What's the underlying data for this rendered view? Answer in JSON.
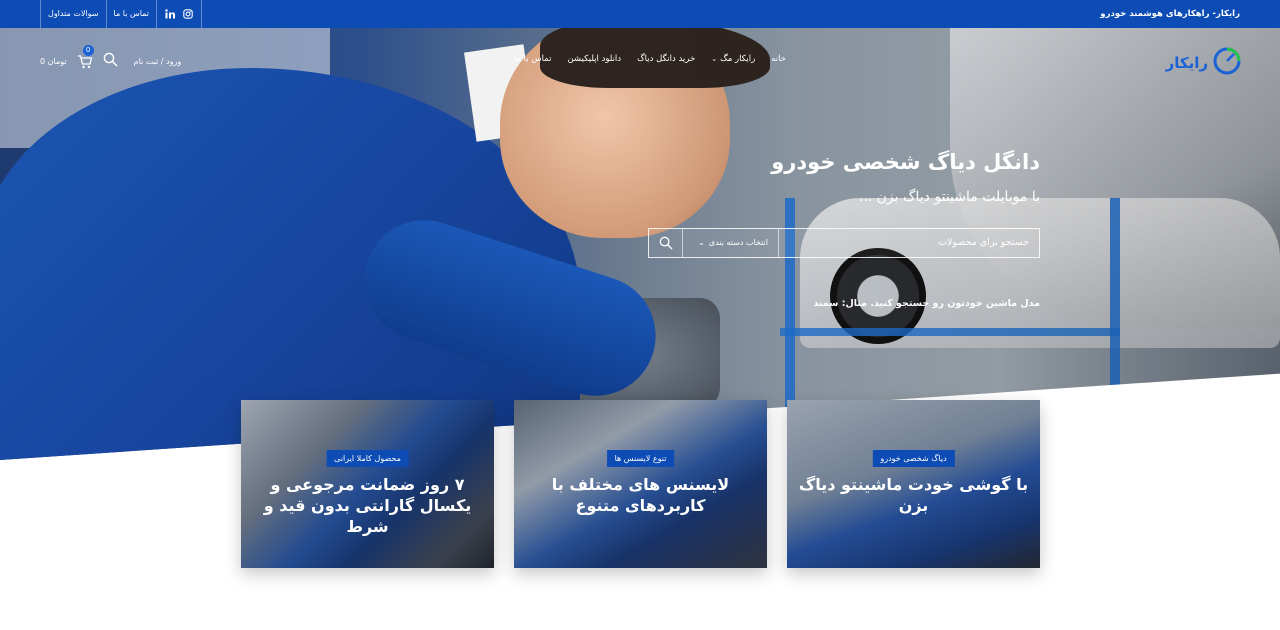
{
  "topbar": {
    "site_tag": "رایکار- راهکارهای هوشمند خودرو",
    "links": [
      "سوالات متداول",
      "تماس با ما"
    ],
    "social_icons": [
      "linkedin-icon",
      "instagram-icon"
    ]
  },
  "header": {
    "logo_text": "رایکار",
    "nav": [
      {
        "label": "خانه"
      },
      {
        "label": "رایکار مگ"
      },
      {
        "label": "خرید دانگل دیاگ"
      },
      {
        "label": "دانلود اپلیکیشن"
      },
      {
        "label": "تماس با ما"
      }
    ],
    "login_label": "ورود / ثبت نام",
    "cart_count": "0",
    "cart_amount": "0 تومان"
  },
  "hero": {
    "title": "دانگل دیاگ شخصی خودرو",
    "subtitle": "با موبایلت ماشینتو دیاگ بزن ...",
    "search_placeholder": "جستجو برای محصولات",
    "category_label": "انتخاب دسته بندی",
    "hint": "مدل ماشین خودتون رو جستجو کنید. مثال: سمند"
  },
  "cards": [
    {
      "badge": "دیاگ شخصی خودرو",
      "title": "با گوشی خودت ماشینتو دیاگ بزن"
    },
    {
      "badge": "تنوع لایسنس ها",
      "title": "لایسنس های مختلف با کاربردهای متنوع"
    },
    {
      "badge": "محصول کاملا ایرانی",
      "title": "۷ روز ضمانت مرجوعی و یکسال گارانتی بدون قید و شرط"
    }
  ],
  "colors": {
    "brand": "#0d4bb5",
    "accent": "#1a62d6"
  }
}
